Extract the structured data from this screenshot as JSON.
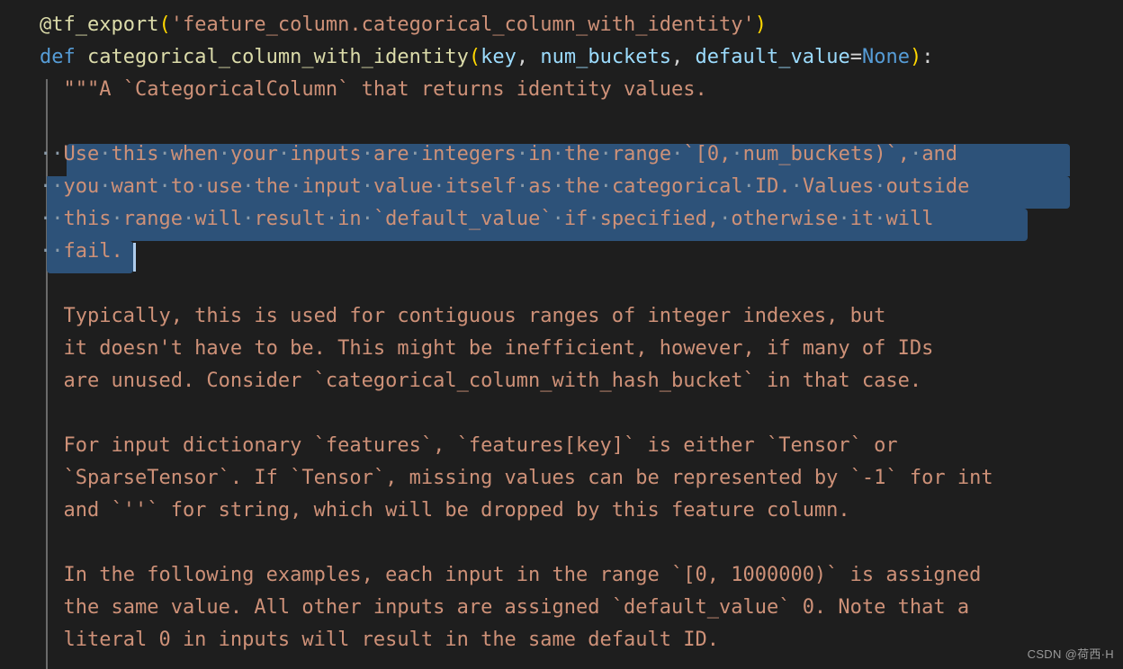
{
  "editor": {
    "background_color": "#1e1e1e",
    "selection_color": "#2d5279",
    "indent_guide_color": "#6a6a6a",
    "caret_color": "#aeccec",
    "font_size_px": 22,
    "line_height_px": 36
  },
  "colors": {
    "decorator": "#dcdcaa",
    "keyword": "#569cd6",
    "function_name": "#dcdcaa",
    "parameter": "#9cdcfe",
    "punctuation": "#d4d4d4",
    "bracket_yellow": "#ffd700",
    "constant": "#569cd6",
    "string": "#ce9178",
    "docstring": "#ce9178",
    "whitespace_dot": "#8a9aa8"
  },
  "code": {
    "decorator_line": {
      "at_name": "@tf_export",
      "open_paren": "(",
      "string_arg": "'feature_column.categorical_column_with_identity'",
      "close_paren": ")"
    },
    "def_line": {
      "keyword": "def",
      "space": " ",
      "name": "categorical_column_with_identity",
      "open_paren": "(",
      "param1": "key",
      "comma1": ", ",
      "param2": "num_buckets",
      "comma2": ", ",
      "param3": "default_value",
      "equals": "=",
      "default": "None",
      "close_paren": ")",
      "colon": ":"
    },
    "docstring_open_line": "  \"\"\"A `CategoricalColumn` that returns identity values.",
    "blank_line": "",
    "selected_paragraph": [
      "  Use this when your inputs are integers in the range `[0, num_buckets)`, and",
      "  you want to use the input value itself as the categorical ID. Values outside",
      "  this range will result in `default_value` if specified, otherwise it will",
      "  fail."
    ],
    "paragraph_2": [
      "  Typically, this is used for contiguous ranges of integer indexes, but",
      "  it doesn't have to be. This might be inefficient, however, if many of IDs",
      "  are unused. Consider `categorical_column_with_hash_bucket` in that case."
    ],
    "paragraph_3": [
      "  For input dictionary `features`, `features[key]` is either `Tensor` or",
      "  `SparseTensor`. If `Tensor`, missing values can be represented by `-1` for int",
      "  and `''` for string, which will be dropped by this feature column."
    ],
    "paragraph_4": [
      "  In the following examples, each input in the range `[0, 1000000)` is assigned",
      "  the same value. All other inputs are assigned `default_value` 0. Note that a",
      "  literal 0 in inputs will result in the same default ID."
    ]
  },
  "selection": {
    "active": true,
    "line_count": 4,
    "whitespace_dot_char": "·"
  },
  "watermark": {
    "text": "CSDN @荷西·H"
  }
}
